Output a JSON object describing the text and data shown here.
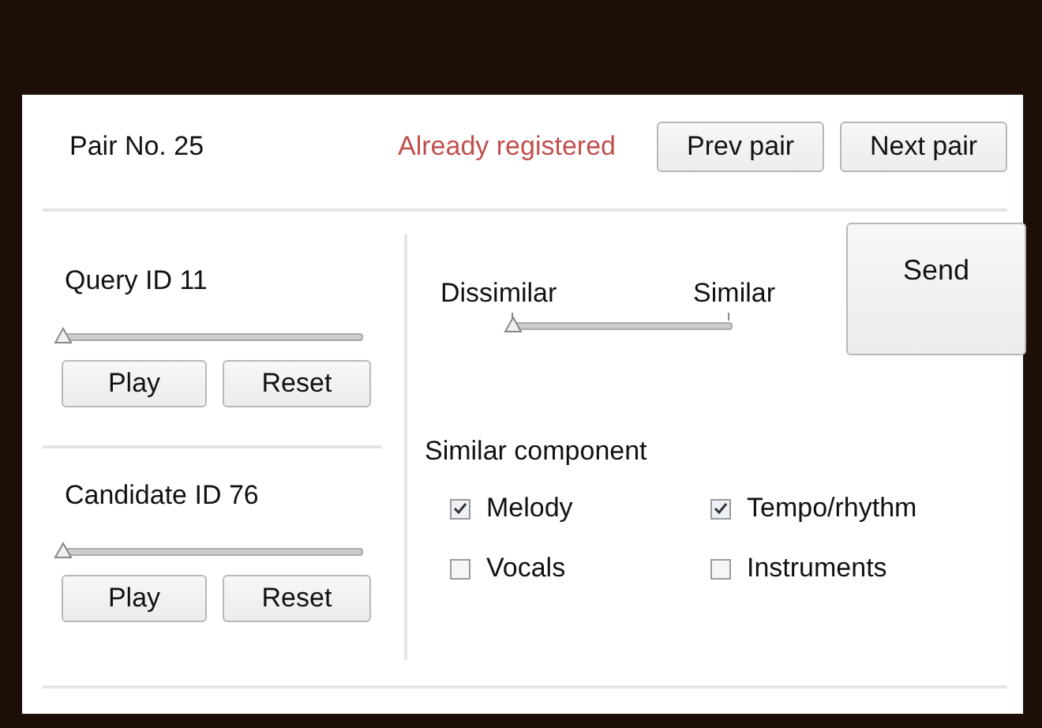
{
  "header": {
    "pair_label": "Pair No. 25",
    "status": "Already registered",
    "buttons": [
      "Prev pair",
      "Next pair"
    ]
  },
  "players": [
    {
      "title": "Query ID 11",
      "level": 0,
      "buttons": [
        "Play",
        "Reset"
      ]
    },
    {
      "title": "Candidate ID 76",
      "level": 0,
      "buttons": [
        "Play",
        "Reset"
      ]
    }
  ],
  "similarity": {
    "min_label": "Dissimilar",
    "max_label": "Similar",
    "level": 0
  },
  "send_button": "Send",
  "components": {
    "title": "Similar component",
    "options": [
      {
        "label": "Melody",
        "checked": true
      },
      {
        "label": "Tempo/rhythm",
        "checked": true
      },
      {
        "label": "Vocals",
        "checked": false
      },
      {
        "label": "Instruments",
        "checked": false
      }
    ]
  }
}
